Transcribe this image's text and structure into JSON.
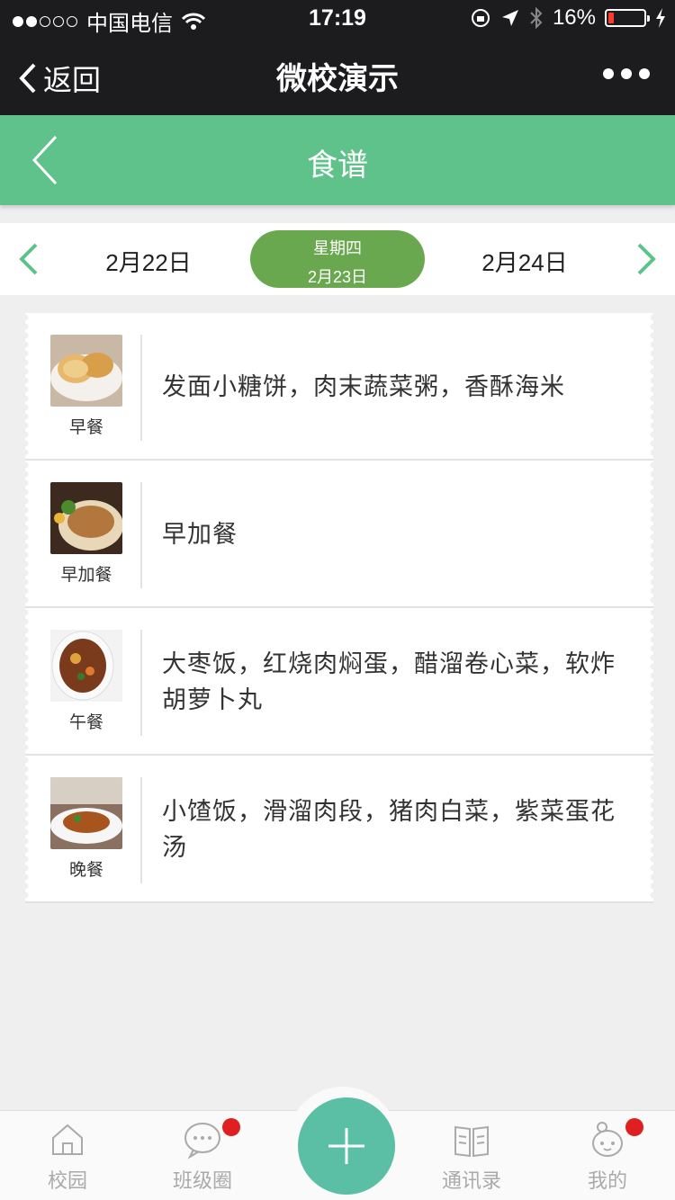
{
  "status_bar": {
    "carrier": "中国电信",
    "time": "17:19",
    "battery": "16%"
  },
  "nav": {
    "back_label": "返回",
    "title": "微校演示"
  },
  "header": {
    "title": "食谱"
  },
  "dates": {
    "prev": "2月22日",
    "current_weekday": "星期四",
    "current": "2月23日",
    "next": "2月24日"
  },
  "meals": [
    {
      "label": "早餐",
      "desc": "发面小糖饼，肉末蔬菜粥，香酥海米"
    },
    {
      "label": "早加餐",
      "desc": "早加餐"
    },
    {
      "label": "午餐",
      "desc": "大枣饭，红烧肉焖蛋，醋溜卷心菜，软炸胡萝卜丸"
    },
    {
      "label": "晚餐",
      "desc": "小馇饭，滑溜肉段，猪肉白菜，紫菜蛋花汤"
    }
  ],
  "tabs": [
    {
      "label": "校园",
      "icon": "home-icon"
    },
    {
      "label": "班级圈",
      "icon": "chat-bubble-icon"
    },
    {
      "label": "通讯录",
      "icon": "book-icon"
    },
    {
      "label": "我的",
      "icon": "profile-icon"
    }
  ],
  "colors": {
    "primary_green": "#5ec28a",
    "date_pill": "#6aa84f",
    "plus": "#5bbfa6",
    "badge": "#e02020"
  }
}
